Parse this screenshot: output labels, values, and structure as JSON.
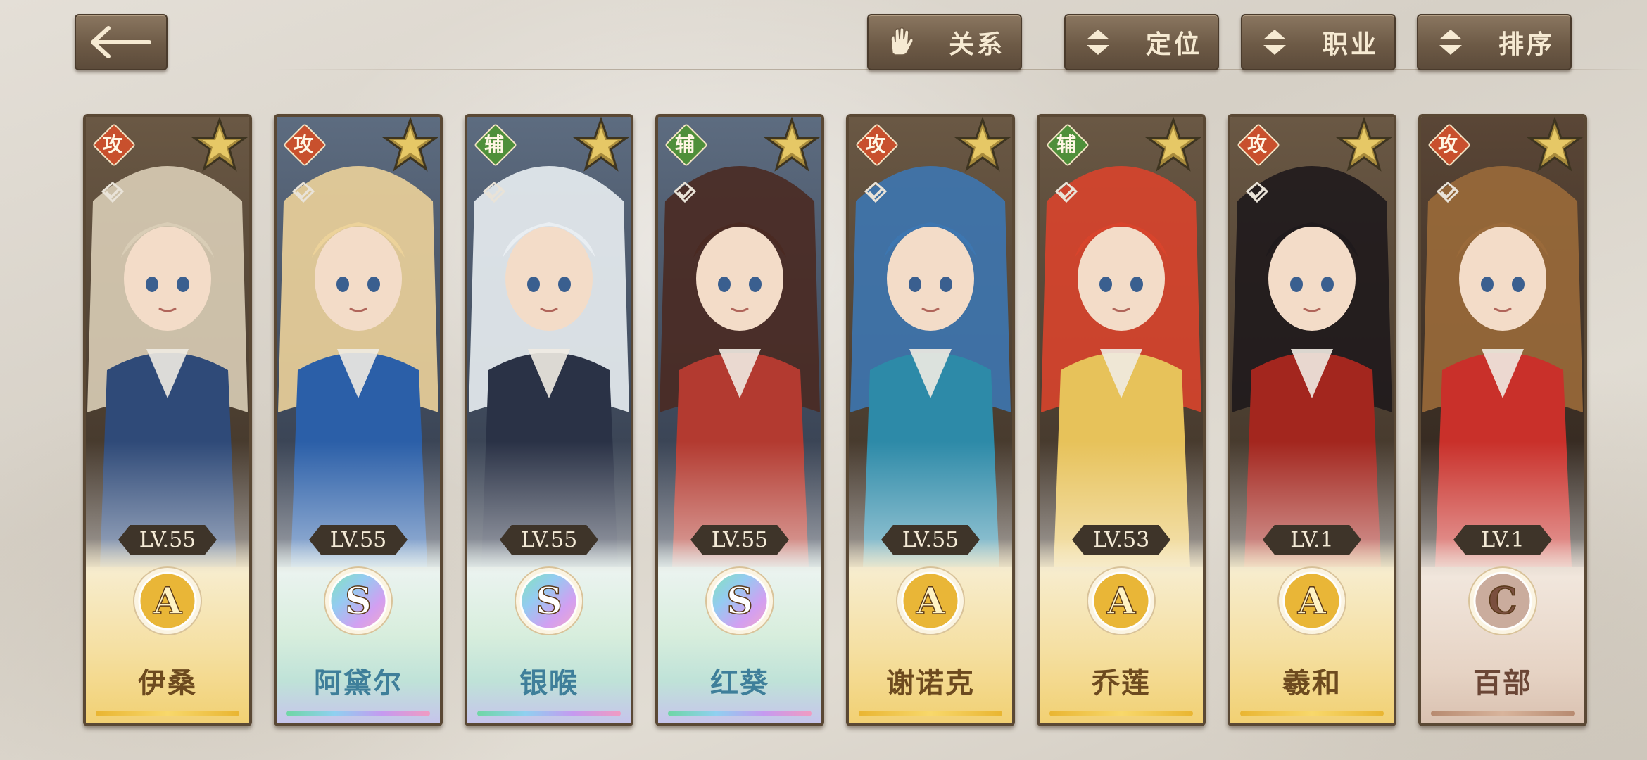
{
  "header": {
    "back_icon": "arrow-left-icon",
    "filters": [
      {
        "label": "关系",
        "icon": "glove-icon"
      },
      {
        "label": "定位",
        "icon": "sort-updown-icon"
      },
      {
        "label": "职业",
        "icon": "sort-updown-icon"
      },
      {
        "label": "排序",
        "icon": "sort-updown-icon"
      }
    ]
  },
  "colors": {
    "button_bg": "#6d5a46",
    "button_text": "#f6ead2",
    "attack_badge": "#c8502d",
    "support_badge": "#4f8f3a",
    "gold_rank": "#f1cf6f",
    "level_tag": "#3e3429"
  },
  "characters": [
    {
      "name": "伊桑",
      "level": "LV.55",
      "role": "攻",
      "rank": "A",
      "frame": "gold",
      "hair": "#d9cdb6",
      "outfit": "#2f4a78"
    },
    {
      "name": "阿黛尔",
      "level": "LV.55",
      "role": "攻",
      "rank": "S",
      "frame": "rainbow",
      "hair": "#ecd29a",
      "outfit": "#2b5fa8"
    },
    {
      "name": "银喉",
      "level": "LV.55",
      "role": "辅",
      "rank": "S",
      "frame": "rainbow",
      "hair": "#e9eef2",
      "outfit": "#2a3246"
    },
    {
      "name": "红葵",
      "level": "LV.55",
      "role": "辅",
      "rank": "S",
      "frame": "rainbow",
      "hair": "#4a2a22",
      "outfit": "#b33a30"
    },
    {
      "name": "谢诺克",
      "level": "LV.55",
      "role": "攻",
      "rank": "A",
      "frame": "gold",
      "hair": "#3d76b0",
      "outfit": "#2d8aa8"
    },
    {
      "name": "乔莲",
      "level": "LV.53",
      "role": "辅",
      "rank": "A",
      "frame": "gold",
      "hair": "#d8442c",
      "outfit": "#e7c25a"
    },
    {
      "name": "羲和",
      "level": "LV.1",
      "role": "攻",
      "rank": "A",
      "frame": "gold",
      "hair": "#1f1a1c",
      "outfit": "#a3261e"
    },
    {
      "name": "百部",
      "level": "LV.1",
      "role": "攻",
      "rank": "C",
      "frame": "bronze",
      "hair": "#9a6a3a",
      "outfit": "#c9302a"
    }
  ]
}
